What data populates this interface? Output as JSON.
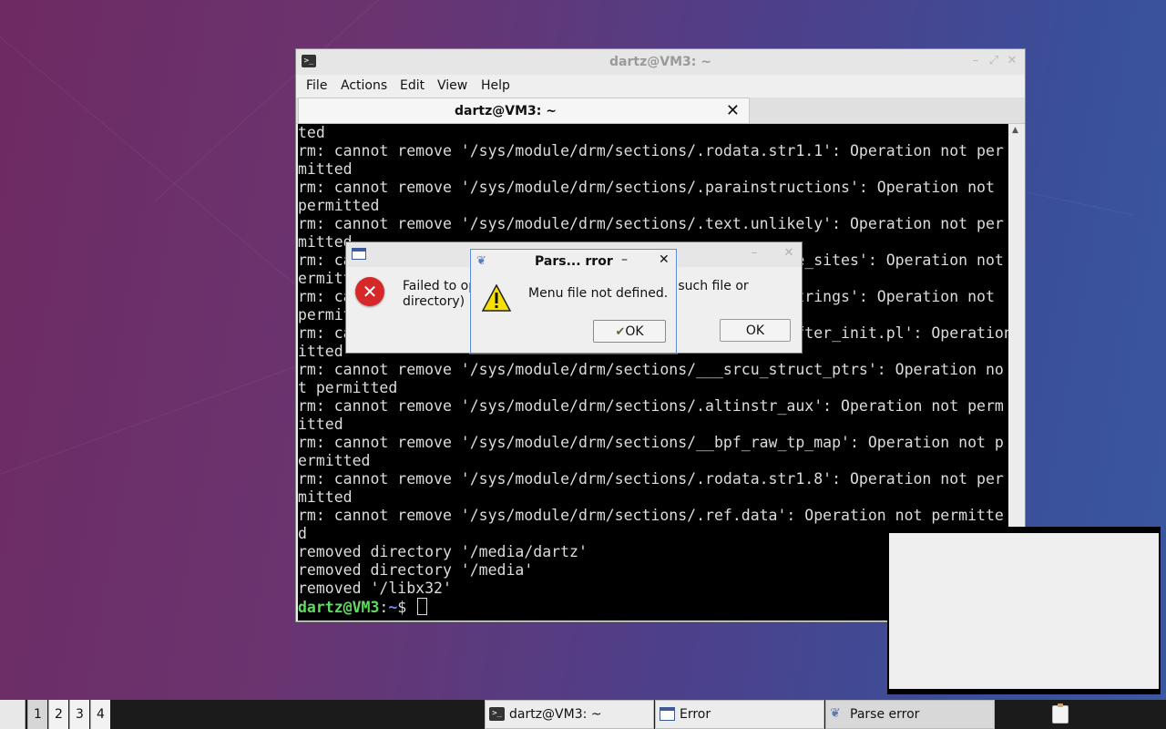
{
  "terminal": {
    "title": "dartz@VM3: ~",
    "icon": "terminal-icon",
    "window_controls": [
      "minimize",
      "maximize",
      "close"
    ],
    "menu": [
      "File",
      "Actions",
      "Edit",
      "View",
      "Help"
    ],
    "tab_label": "dartz@VM3: ~",
    "output_lines": [
      "ted",
      "rm: cannot remove '/sys/module/drm/sections/.rodata.str1.1': Operation not per",
      "mitted",
      "rm: cannot remove '/sys/module/drm/sections/.parainstructions': Operation not",
      "permitted",
      "rm: cannot remove '/sys/module/drm/sections/.text.unlikely': Operation not per",
      "mitted",
      "rm: cannot remove '/sys/module/drm/sections/__jump_table_sites': Operation not p",
      "ermitted",
      "rm: cannot remove '/sys/module/drm/sections/__ksymtab_strings': Operation not",
      "permitted",
      "rm: cannot remove '/sys/module/drm/sections/.data..ro_after_init.pl': Operation not perm",
      "itted",
      "rm: cannot remove '/sys/module/drm/sections/___srcu_struct_ptrs': Operation no",
      "t permitted",
      "rm: cannot remove '/sys/module/drm/sections/.altinstr_aux': Operation not perm",
      "itted",
      "rm: cannot remove '/sys/module/drm/sections/__bpf_raw_tp_map': Operation not p",
      "ermitted",
      "rm: cannot remove '/sys/module/drm/sections/.rodata.str1.8': Operation not per",
      "mitted",
      "rm: cannot remove '/sys/module/drm/sections/.ref.data': Operation not permitte",
      "d",
      "removed directory '/media/dartz'",
      "removed directory '/media'",
      "removed '/libx32'"
    ],
    "prompt_user": "dartz@VM3",
    "prompt_sep": ":",
    "prompt_path": "~",
    "prompt_symbol": "$ "
  },
  "error_dialog": {
    "title": "Error",
    "message": "Failed to open file '/etc/xdg/lxqt/menu': No such file or directory)",
    "ok_label": "OK",
    "icon": "error-icon"
  },
  "parse_dialog": {
    "title": "Pars... rror",
    "message": "Menu file not defined.",
    "ok_label": "OK",
    "icon": "warning-icon"
  },
  "taskbar": {
    "workspaces": [
      "1",
      "2",
      "3",
      "4"
    ],
    "tasks": [
      {
        "label": "dartz@VM3: ~",
        "icon": "terminal-icon"
      },
      {
        "label": "Error",
        "icon": "window-icon"
      },
      {
        "label": "Parse error",
        "icon": "app-icon"
      }
    ],
    "tray_icon": "clipboard-icon"
  }
}
